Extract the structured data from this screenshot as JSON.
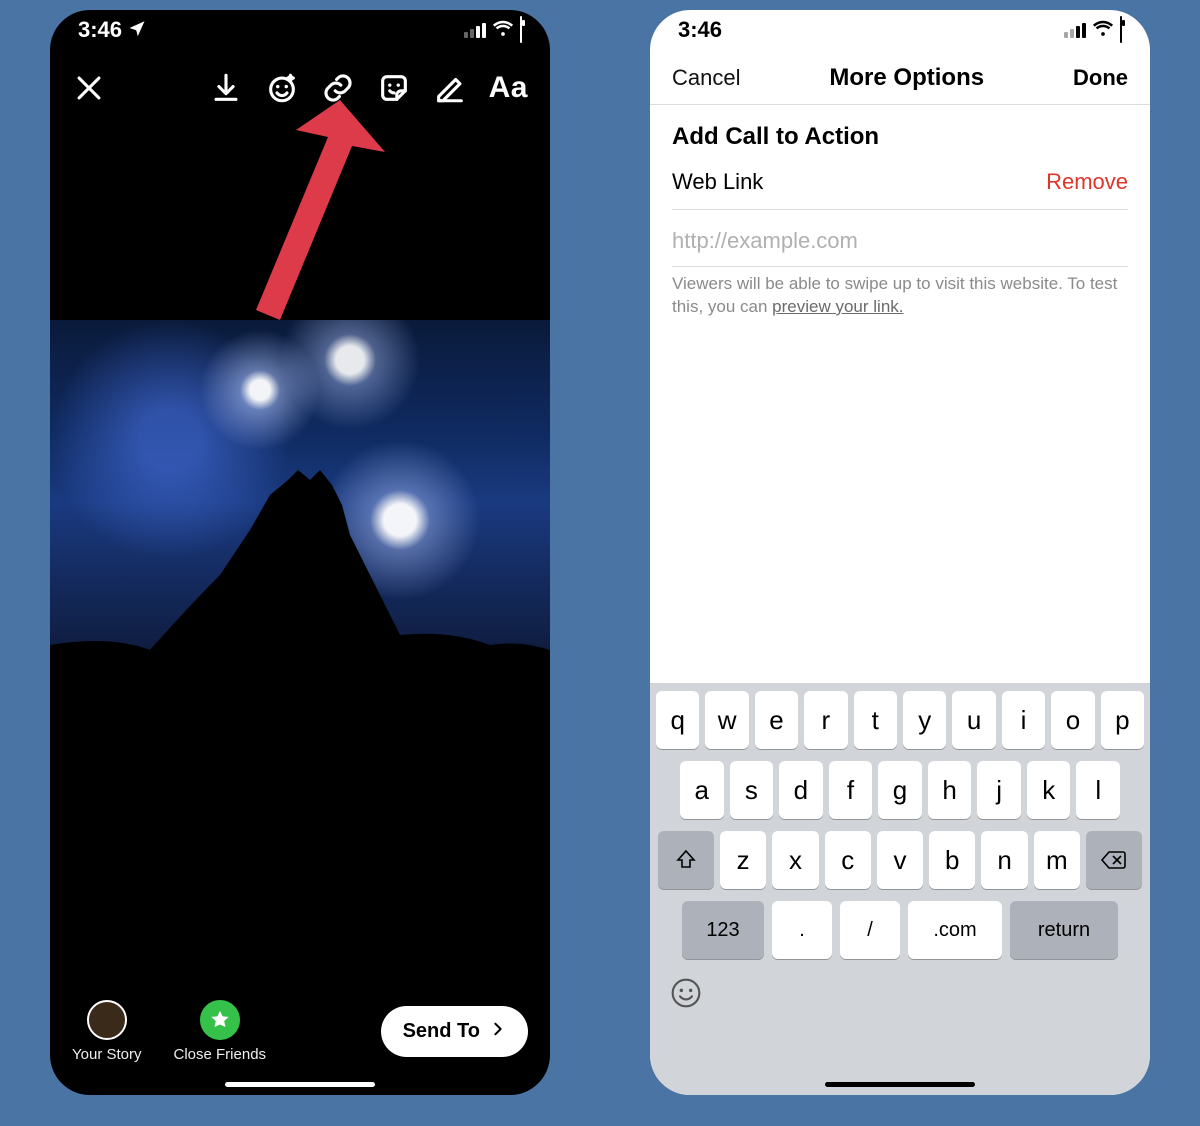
{
  "left_phone": {
    "status_time": "3:46",
    "toolbar": {
      "aa_label": "Aa"
    },
    "bottom": {
      "your_story_label": "Your Story",
      "close_friends_label": "Close Friends",
      "send_to_label": "Send To"
    }
  },
  "right_phone": {
    "status_time": "3:46",
    "nav": {
      "cancel": "Cancel",
      "title": "More Options",
      "done": "Done"
    },
    "section": {
      "heading": "Add Call to Action",
      "web_link_label": "Web Link",
      "remove_label": "Remove",
      "url_placeholder": "http://example.com",
      "help_text_1": "Viewers will be able to swipe up to visit this website. To test this, you can ",
      "help_link": "preview your link."
    },
    "keyboard": {
      "row1": [
        "q",
        "w",
        "e",
        "r",
        "t",
        "y",
        "u",
        "i",
        "o",
        "p"
      ],
      "row2": [
        "a",
        "s",
        "d",
        "f",
        "g",
        "h",
        "j",
        "k",
        "l"
      ],
      "row3": [
        "z",
        "x",
        "c",
        "v",
        "b",
        "n",
        "m"
      ],
      "k123": "123",
      "dot": ".",
      "slash": "/",
      "dotcom": ".com",
      "return": "return"
    }
  }
}
